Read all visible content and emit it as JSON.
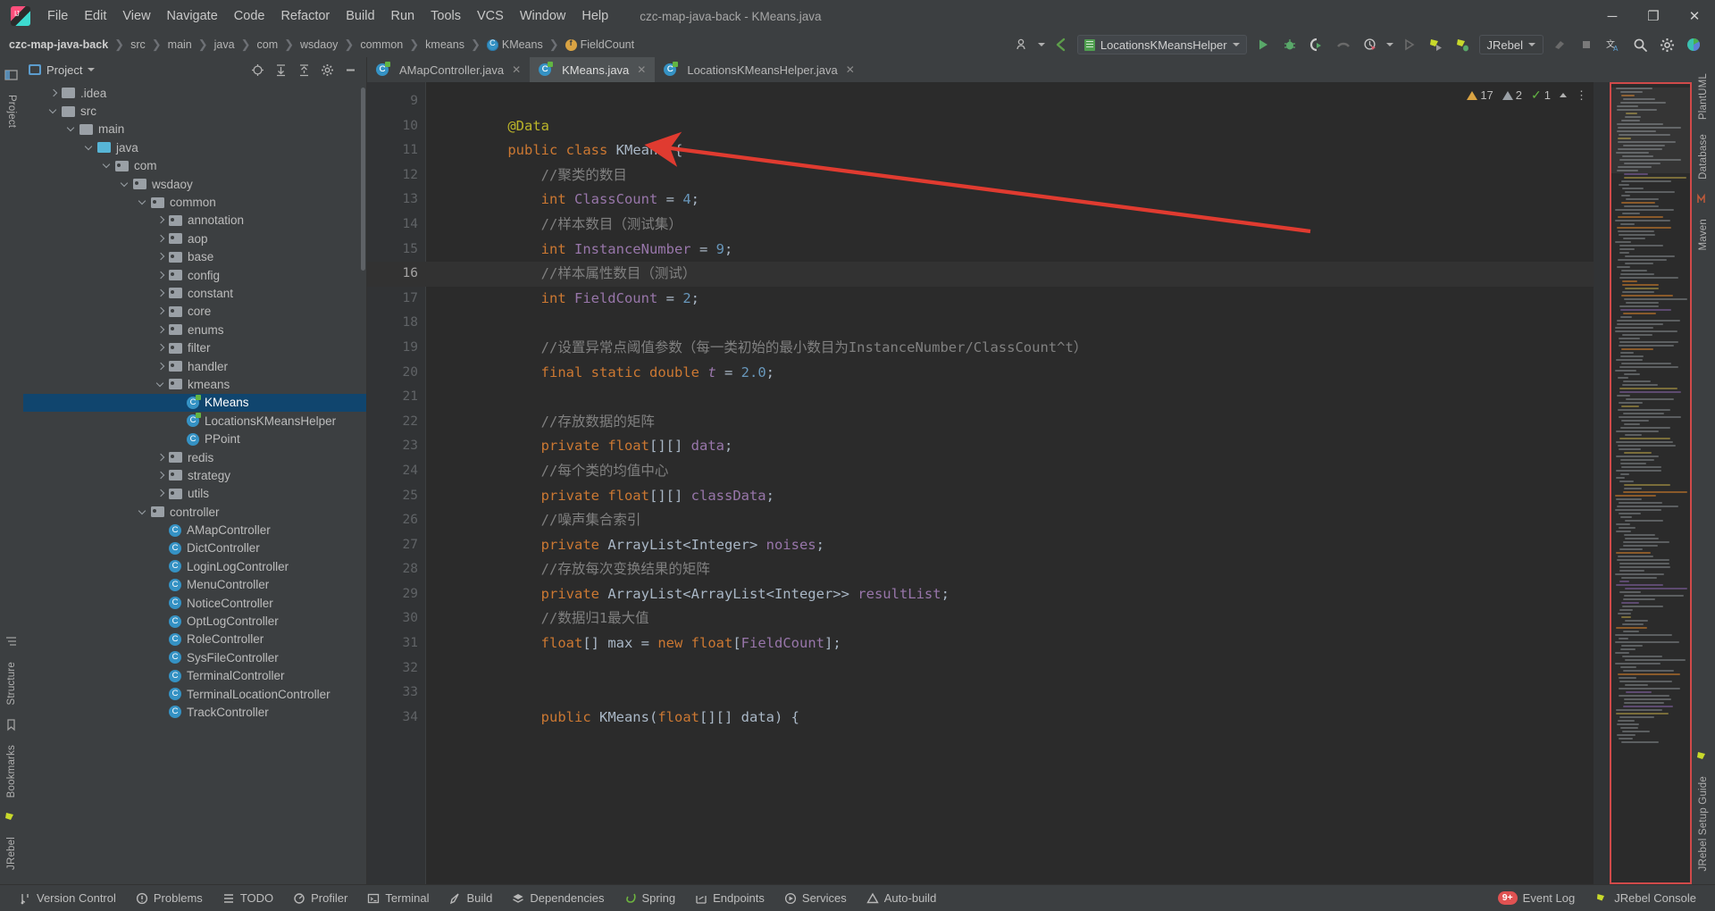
{
  "window": {
    "title": "czc-map-java-back - KMeans.java",
    "logo_icon": "intellij-idea-logo",
    "minimize_icon": "minimize-icon",
    "maximize_icon": "maximize-icon",
    "close_icon": "close-icon",
    "minimize_glyph": "─",
    "maximize_glyph": "❐",
    "close_glyph": "✕"
  },
  "menubar": {
    "items": [
      {
        "label": "File"
      },
      {
        "label": "Edit"
      },
      {
        "label": "View"
      },
      {
        "label": "Navigate"
      },
      {
        "label": "Code"
      },
      {
        "label": "Refactor"
      },
      {
        "label": "Build"
      },
      {
        "label": "Run"
      },
      {
        "label": "Tools"
      },
      {
        "label": "VCS"
      },
      {
        "label": "Window"
      },
      {
        "label": "Help"
      }
    ]
  },
  "navbar": {
    "breadcrumbs": [
      {
        "label": "czc-map-java-back",
        "icon": null,
        "bold": true
      },
      {
        "label": "src",
        "icon": null,
        "bold": false
      },
      {
        "label": "main",
        "icon": null,
        "bold": false
      },
      {
        "label": "java",
        "icon": null,
        "bold": false
      },
      {
        "label": "com",
        "icon": null,
        "bold": false
      },
      {
        "label": "wsdaoy",
        "icon": null,
        "bold": false
      },
      {
        "label": "common",
        "icon": null,
        "bold": false
      },
      {
        "label": "kmeans",
        "icon": null,
        "bold": false
      },
      {
        "label": "KMeans",
        "icon": "class-icon",
        "bold": false
      },
      {
        "label": "FieldCount",
        "icon": "field-icon",
        "bold": false
      }
    ],
    "separator": "❯",
    "run_config": "LocationsKMeansHelper",
    "jrebel_label": "JRebel",
    "toolbar_icons": [
      "user-settings-icon",
      "back-navigation-icon",
      "run-icon",
      "debug-icon",
      "run-with-coverage-icon",
      "profiler-icon",
      "run-history-icon",
      "stop-icon",
      "jrebel-run-icon",
      "jrebel-debug-icon",
      "attach-icon",
      "stop-square-icon",
      "translate-icon",
      "search-everywhere-icon",
      "settings-gear-icon",
      "plugin-icon"
    ]
  },
  "project_panel": {
    "title": "Project",
    "title_icon": "project-view-icon",
    "header_actions": [
      "locate-icon",
      "expand-all-icon",
      "collapse-all-icon",
      "settings-gear-icon",
      "hide-icon"
    ],
    "tree": [
      {
        "label": ".idea",
        "depth": 1,
        "kind": "folder",
        "arrow": "right",
        "selected": false
      },
      {
        "label": "src",
        "depth": 1,
        "kind": "folder",
        "arrow": "down",
        "selected": false
      },
      {
        "label": "main",
        "depth": 2,
        "kind": "folder",
        "arrow": "down",
        "selected": false
      },
      {
        "label": "java",
        "depth": 3,
        "kind": "source",
        "arrow": "down",
        "selected": false
      },
      {
        "label": "com",
        "depth": 4,
        "kind": "package",
        "arrow": "down",
        "selected": false
      },
      {
        "label": "wsdaoy",
        "depth": 5,
        "kind": "package",
        "arrow": "down",
        "selected": false
      },
      {
        "label": "common",
        "depth": 6,
        "kind": "package",
        "arrow": "down",
        "selected": false
      },
      {
        "label": "annotation",
        "depth": 7,
        "kind": "package",
        "arrow": "right",
        "selected": false
      },
      {
        "label": "aop",
        "depth": 7,
        "kind": "package",
        "arrow": "right",
        "selected": false
      },
      {
        "label": "base",
        "depth": 7,
        "kind": "package",
        "arrow": "right",
        "selected": false
      },
      {
        "label": "config",
        "depth": 7,
        "kind": "package",
        "arrow": "right",
        "selected": false
      },
      {
        "label": "constant",
        "depth": 7,
        "kind": "package",
        "arrow": "right",
        "selected": false
      },
      {
        "label": "core",
        "depth": 7,
        "kind": "package",
        "arrow": "right",
        "selected": false
      },
      {
        "label": "enums",
        "depth": 7,
        "kind": "package",
        "arrow": "right",
        "selected": false
      },
      {
        "label": "filter",
        "depth": 7,
        "kind": "package",
        "arrow": "right",
        "selected": false
      },
      {
        "label": "handler",
        "depth": 7,
        "kind": "package",
        "arrow": "right",
        "selected": false
      },
      {
        "label": "kmeans",
        "depth": 7,
        "kind": "package",
        "arrow": "down",
        "selected": false
      },
      {
        "label": "KMeans",
        "depth": 8,
        "kind": "class-lombok",
        "arrow": "none",
        "selected": true
      },
      {
        "label": "LocationsKMeansHelper",
        "depth": 8,
        "kind": "class-lombok",
        "arrow": "none",
        "selected": false
      },
      {
        "label": "PPoint",
        "depth": 8,
        "kind": "class",
        "arrow": "none",
        "selected": false
      },
      {
        "label": "redis",
        "depth": 7,
        "kind": "package",
        "arrow": "right",
        "selected": false
      },
      {
        "label": "strategy",
        "depth": 7,
        "kind": "package",
        "arrow": "right",
        "selected": false
      },
      {
        "label": "utils",
        "depth": 7,
        "kind": "package",
        "arrow": "right",
        "selected": false
      },
      {
        "label": "controller",
        "depth": 6,
        "kind": "package",
        "arrow": "down",
        "selected": false
      },
      {
        "label": "AMapController",
        "depth": 7,
        "kind": "class",
        "arrow": "none",
        "selected": false
      },
      {
        "label": "DictController",
        "depth": 7,
        "kind": "class",
        "arrow": "none",
        "selected": false
      },
      {
        "label": "LoginLogController",
        "depth": 7,
        "kind": "class",
        "arrow": "none",
        "selected": false
      },
      {
        "label": "MenuController",
        "depth": 7,
        "kind": "class",
        "arrow": "none",
        "selected": false
      },
      {
        "label": "NoticeController",
        "depth": 7,
        "kind": "class",
        "arrow": "none",
        "selected": false
      },
      {
        "label": "OptLogController",
        "depth": 7,
        "kind": "class",
        "arrow": "none",
        "selected": false
      },
      {
        "label": "RoleController",
        "depth": 7,
        "kind": "class",
        "arrow": "none",
        "selected": false
      },
      {
        "label": "SysFileController",
        "depth": 7,
        "kind": "class",
        "arrow": "none",
        "selected": false
      },
      {
        "label": "TerminalController",
        "depth": 7,
        "kind": "class",
        "arrow": "none",
        "selected": false
      },
      {
        "label": "TerminalLocationController",
        "depth": 7,
        "kind": "class",
        "arrow": "none",
        "selected": false
      },
      {
        "label": "TrackController",
        "depth": 7,
        "kind": "class",
        "arrow": "none",
        "selected": false
      }
    ]
  },
  "left_rail": {
    "items": [
      {
        "label": "Project",
        "icon": "project-tool-icon"
      },
      {
        "label": "Structure",
        "icon": "structure-tool-icon"
      },
      {
        "label": "Bookmarks",
        "icon": "bookmarks-tool-icon"
      },
      {
        "label": "JRebel",
        "icon": "jrebel-tool-icon"
      }
    ]
  },
  "right_rail": {
    "items": [
      {
        "label": "PlantUML",
        "icon": "plantuml-tool-icon"
      },
      {
        "label": "Database",
        "icon": "database-tool-icon"
      },
      {
        "label": "Maven",
        "icon": "maven-tool-icon"
      },
      {
        "label": "JRebel Setup Guide",
        "icon": "jrebel-guide-icon"
      }
    ]
  },
  "editor": {
    "tabs": [
      {
        "label": "AMapController.java",
        "icon": "java-class-icon",
        "active": false,
        "close": "✕"
      },
      {
        "label": "KMeans.java",
        "icon": "java-class-icon",
        "active": true,
        "close": "✕"
      },
      {
        "label": "LocationsKMeansHelper.java",
        "icon": "java-class-icon",
        "active": false,
        "close": "✕"
      }
    ],
    "inspections": {
      "warnings": "17",
      "weak_warnings": "2",
      "typos": "1",
      "warning_icon": "warning-triangle-icon",
      "weak_warning_icon": "weak-warning-triangle-icon",
      "ok_icon": "inspection-ok-icon",
      "collapse_icon": "chevron-up-icon",
      "menu_icon": "more-options-icon"
    },
    "first_line_number": 9,
    "current_line": 16,
    "run_marker_line": 11,
    "lines": [
      {
        "n": 9,
        "tokens": []
      },
      {
        "n": 10,
        "tokens": [
          {
            "t": "@Data",
            "c": "ann",
            "indent": 4
          }
        ]
      },
      {
        "n": 11,
        "tokens": [
          {
            "t": "public ",
            "c": "kw",
            "indent": 4
          },
          {
            "t": "class ",
            "c": "kw"
          },
          {
            "t": "KMeans ",
            "c": "txt"
          },
          {
            "t": "{",
            "c": "txt"
          }
        ],
        "run": true
      },
      {
        "n": 12,
        "tokens": [
          {
            "t": "//聚类的数目",
            "c": "cmt",
            "indent": 8
          }
        ]
      },
      {
        "n": 13,
        "tokens": [
          {
            "t": "int ",
            "c": "kw",
            "indent": 8
          },
          {
            "t": "ClassCount ",
            "c": "fld"
          },
          {
            "t": "= ",
            "c": "txt"
          },
          {
            "t": "4",
            "c": "num"
          },
          {
            "t": ";",
            "c": "txt"
          }
        ]
      },
      {
        "n": 14,
        "tokens": [
          {
            "t": "//样本数目（测试集）",
            "c": "cmt",
            "indent": 8
          }
        ]
      },
      {
        "n": 15,
        "tokens": [
          {
            "t": "int ",
            "c": "kw",
            "indent": 8
          },
          {
            "t": "InstanceNumber ",
            "c": "fld"
          },
          {
            "t": "= ",
            "c": "txt"
          },
          {
            "t": "9",
            "c": "num"
          },
          {
            "t": ";",
            "c": "txt"
          }
        ]
      },
      {
        "n": 16,
        "tokens": [
          {
            "t": "//样本属性数目（测试）",
            "c": "cmt",
            "indent": 8
          }
        ],
        "current": true
      },
      {
        "n": 17,
        "tokens": [
          {
            "t": "int ",
            "c": "kw",
            "indent": 8
          },
          {
            "t": "FieldCount ",
            "c": "fld"
          },
          {
            "t": "= ",
            "c": "txt"
          },
          {
            "t": "2",
            "c": "num"
          },
          {
            "t": ";",
            "c": "txt"
          }
        ]
      },
      {
        "n": 18,
        "tokens": []
      },
      {
        "n": 19,
        "tokens": [
          {
            "t": "//设置异常点阈值参数（每一类初始的最小数目为InstanceNumber/ClassCount^t）",
            "c": "cmt",
            "indent": 8
          }
        ]
      },
      {
        "n": 20,
        "tokens": [
          {
            "t": "final ",
            "c": "kw",
            "indent": 8
          },
          {
            "t": "static ",
            "c": "kw"
          },
          {
            "t": "double ",
            "c": "kw"
          },
          {
            "t": "t ",
            "c": "fld-i"
          },
          {
            "t": "= ",
            "c": "txt"
          },
          {
            "t": "2.0",
            "c": "num"
          },
          {
            "t": ";",
            "c": "txt"
          }
        ]
      },
      {
        "n": 21,
        "tokens": []
      },
      {
        "n": 22,
        "tokens": [
          {
            "t": "//存放数据的矩阵",
            "c": "cmt",
            "indent": 8
          }
        ]
      },
      {
        "n": 23,
        "tokens": [
          {
            "t": "private ",
            "c": "kw",
            "indent": 8
          },
          {
            "t": "float",
            "c": "kw"
          },
          {
            "t": "[][] ",
            "c": "txt"
          },
          {
            "t": "data",
            "c": "fld"
          },
          {
            "t": ";",
            "c": "txt"
          }
        ]
      },
      {
        "n": 24,
        "tokens": [
          {
            "t": "//每个类的均值中心",
            "c": "cmt",
            "indent": 8
          }
        ]
      },
      {
        "n": 25,
        "tokens": [
          {
            "t": "private ",
            "c": "kw",
            "indent": 8
          },
          {
            "t": "float",
            "c": "kw"
          },
          {
            "t": "[][] ",
            "c": "txt"
          },
          {
            "t": "classData",
            "c": "fld"
          },
          {
            "t": ";",
            "c": "txt"
          }
        ]
      },
      {
        "n": 26,
        "tokens": [
          {
            "t": "//噪声集合索引",
            "c": "cmt",
            "indent": 8
          }
        ]
      },
      {
        "n": 27,
        "tokens": [
          {
            "t": "private ",
            "c": "kw",
            "indent": 8
          },
          {
            "t": "ArrayList<Integer> ",
            "c": "txt"
          },
          {
            "t": "noises",
            "c": "fld"
          },
          {
            "t": ";",
            "c": "txt"
          }
        ]
      },
      {
        "n": 28,
        "tokens": [
          {
            "t": "//存放每次变换结果的矩阵",
            "c": "cmt",
            "indent": 8
          }
        ]
      },
      {
        "n": 29,
        "tokens": [
          {
            "t": "private ",
            "c": "kw",
            "indent": 8
          },
          {
            "t": "ArrayList<ArrayList<Integer>> ",
            "c": "txt"
          },
          {
            "t": "resultList",
            "c": "fld"
          },
          {
            "t": ";",
            "c": "txt"
          }
        ]
      },
      {
        "n": 30,
        "tokens": [
          {
            "t": "//数据归1最大值",
            "c": "cmt",
            "indent": 8
          }
        ]
      },
      {
        "n": 31,
        "tokens": [
          {
            "t": "float",
            "c": "kw",
            "indent": 8
          },
          {
            "t": "[] ",
            "c": "txt"
          },
          {
            "t": "max ",
            "c": "txt"
          },
          {
            "t": "= ",
            "c": "txt"
          },
          {
            "t": "new ",
            "c": "kw"
          },
          {
            "t": "float",
            "c": "kw"
          },
          {
            "t": "[",
            "c": "txt"
          },
          {
            "t": "FieldCount",
            "c": "fld"
          },
          {
            "t": "];",
            "c": "txt"
          }
        ]
      },
      {
        "n": 32,
        "tokens": []
      },
      {
        "n": 33,
        "tokens": []
      },
      {
        "n": 34,
        "tokens": [
          {
            "t": "public ",
            "c": "kw",
            "indent": 8
          },
          {
            "t": "KMeans",
            "c": "txt"
          },
          {
            "t": "(",
            "c": "txt"
          },
          {
            "t": "float",
            "c": "kw"
          },
          {
            "t": "[][] ",
            "c": "txt"
          },
          {
            "t": "data",
            "c": "txt"
          },
          {
            "t": ") {",
            "c": "txt"
          }
        ],
        "annot": "@"
      }
    ]
  },
  "annotation": {
    "arrow_color": "#e03b30",
    "arrow_name": "red-pointer-arrow"
  },
  "statusbar": {
    "left_items": [
      {
        "label": "Version Control",
        "icon": "version-control-icon"
      },
      {
        "label": "Problems",
        "icon": "problems-icon"
      },
      {
        "label": "TODO",
        "icon": "todo-icon"
      },
      {
        "label": "Profiler",
        "icon": "profiler-icon"
      },
      {
        "label": "Terminal",
        "icon": "terminal-icon"
      },
      {
        "label": "Build",
        "icon": "build-icon"
      },
      {
        "label": "Dependencies",
        "icon": "dependencies-icon"
      },
      {
        "label": "Spring",
        "icon": "spring-icon"
      },
      {
        "label": "Endpoints",
        "icon": "endpoints-icon"
      },
      {
        "label": "Services",
        "icon": "services-icon"
      },
      {
        "label": "Auto-build",
        "icon": "auto-build-icon"
      }
    ],
    "right_items": [
      {
        "label": "Event Log",
        "icon": "event-log-icon",
        "badge": "9+"
      },
      {
        "label": "JRebel Console",
        "icon": "jrebel-console-icon",
        "badge": null
      }
    ]
  },
  "colors": {
    "chrome_bg": "#3c3f41",
    "editor_bg": "#2b2b2b",
    "gutter_bg": "#313335",
    "selection_blue": "#10456e",
    "keyword_orange": "#cc7832",
    "number_blue": "#6897bb",
    "comment_grey": "#808080",
    "field_purple": "#9876aa",
    "annotation_yellow": "#bbb529",
    "text_default": "#a9b7c6",
    "minimap_border_red": "#d04a4a",
    "accent_green": "#499c54"
  }
}
